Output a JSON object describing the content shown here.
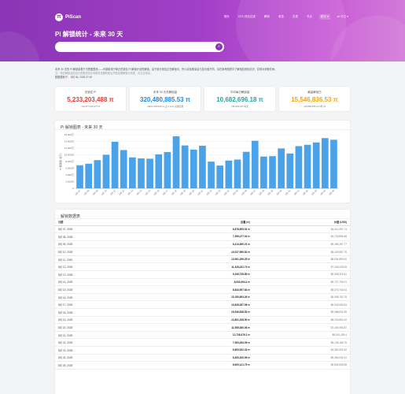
{
  "nav": {
    "logo_mark": "π",
    "logo_text": "PiScan",
    "links": [
      "首页",
      "CEX 钱包过滤",
      "解析",
      "收录",
      "交易",
      "节点"
    ],
    "dropdown": "统计 ▾",
    "language": "zh 中文 ▾"
  },
  "page": {
    "title": "Pi 解锁统计 - 未来 30 天",
    "search_placeholder": "",
    "search_icon": "⌕"
  },
  "intro": {
    "line1": "未来 30 天的 Pi 解锁量基于可视图表统——可能取用于邮迁的钱包 Pi 解锁计划的解锁。由于部分钱包正在解锁中，所以实际数量会与显示值不同，请在参考图表中了解相应钱包情况，并核对到账时间。",
    "line2": "注：钱包解锁会因合约变更或在区块链浏览器转账后不断变更解锁计划表，请注意核实。",
    "line3": "数据更新于：  8月 06, 2025 07:00"
  },
  "stats": [
    {
      "label": "总锁定 Pi",
      "value": "5,233,203,488 π",
      "sub": "≈$1,977,615,377.8",
      "color": "#e53935"
    },
    {
      "label": "未来 30 天总解锁量",
      "value": "320,480,885.53 π",
      "sub": "≈$201,039,504.11  占 6.12% 总锁定量",
      "color": "#1e88e5"
    },
    {
      "label": "平均每日解锁量",
      "value": "10,682,696.18 π",
      "sub": "≈$6,863,187 每天",
      "color": "#26a69a"
    },
    {
      "label": "最高解锁日",
      "value": "15,546,836.53 π",
      "sub": "≈$9,858,655.21  8月 16",
      "color": "#ffa000"
    }
  ],
  "chart_card": {
    "title": "Pi 解锁图表 - 未来 30 天"
  },
  "chart_data": {
    "type": "bar",
    "title": "",
    "xlabel": "",
    "ylabel": "Pi 解锁量 (百万)",
    "ylim": [
      0,
      16000000
    ],
    "yticks": [
      0,
      2000000,
      4000000,
      6000000,
      8000000,
      10000000,
      12000000,
      14000000,
      16000000
    ],
    "ytick_labels": [
      "0",
      "2,000万",
      "4,000万",
      "6,000万",
      "8,000万",
      "10,000万",
      "12,000万",
      "14,000万",
      "16,000万"
    ],
    "grid": true,
    "color": "#4aa3e8",
    "categories": [
      "8月 07",
      "8月 08",
      "8月 09",
      "8月 10",
      "8月 11",
      "8月 12",
      "8月 13",
      "8月 14",
      "8月 15",
      "8月 16",
      "8月 17",
      "8月 18",
      "8月 19",
      "8月 20",
      "8月 21",
      "8月 22",
      "8月 23",
      "8月 24",
      "8月 25",
      "8月 26",
      "8月 27",
      "8月 28",
      "8月 29",
      "8月 30",
      "8月 31",
      "9月 01",
      "9月 02",
      "9月 03",
      "9月 04",
      "9月 05"
    ],
    "values": [
      6878505,
      7359477,
      8414360,
      10027950,
      13901299,
      11425431,
      9245735,
      8932994,
      8843957,
      10150893,
      10828267,
      15546836,
      12801208,
      11555360,
      12728476,
      7963454,
      6800522,
      8300200,
      8600121,
      10900000,
      14200000,
      9500000,
      9600000,
      11900000,
      10400000,
      12600000,
      13000000,
      13700000,
      15000000,
      14500000
    ]
  },
  "table": {
    "title": "解锁数据表",
    "headers": {
      "date": "日期",
      "amount": "总量 (π)",
      "value": "价值 (USD)"
    },
    "rows": [
      {
        "date": "8月 07, 2025",
        "amount": "6,878,505.51 π",
        "value": "$4,410,497.74"
      },
      {
        "date": "8月 08, 2025",
        "amount": "7,359,477.04 π",
        "value": "$4,718,896.68"
      },
      {
        "date": "8月 09, 2025",
        "amount": "8,414,360.21 π",
        "value": "$5,395,287.77"
      },
      {
        "date": "8月 10, 2025",
        "amount": "10,027,950.52 π",
        "value": "$6,429,857.76"
      },
      {
        "date": "8月 11, 2025",
        "amount": "13,901,299.25 π",
        "value": "$8,904,899.00"
      },
      {
        "date": "8月 12, 2025",
        "amount": "11,425,431.74 π",
        "value": "$7,326,028.05"
      },
      {
        "date": "8月 13, 2025",
        "amount": "9,245,735.85 π",
        "value": "$5,928,319.41"
      },
      {
        "date": "8月 14, 2025",
        "amount": "8,932,994.4 π",
        "value": "$5,727,796.01"
      },
      {
        "date": "8月 15, 2025",
        "amount": "8,843,957.64 π",
        "value": "$5,670,745.04"
      },
      {
        "date": "8月 16, 2025",
        "amount": "10,150,893.26 π",
        "value": "$6,508,752.76"
      },
      {
        "date": "8月 17, 2025",
        "amount": "10,828,267.06 π",
        "value": "$6,943,084.84"
      },
      {
        "date": "8月 18, 2025",
        "amount": "15,546,836.53 π",
        "value": "$9,968,631.59"
      },
      {
        "date": "8月 19, 2025",
        "amount": "12,801,208.90 π",
        "value": "$8,203,894.42"
      },
      {
        "date": "8月 20, 2025",
        "amount": "11,555,360.06 π",
        "value": "$7,409,394.87"
      },
      {
        "date": "8月 21, 2025",
        "amount": "12,728,476.1 π",
        "value": "$8,161,429.4"
      },
      {
        "date": "8月 22, 2025",
        "amount": "7,963,454.09 π",
        "value": "$5,106,166.76"
      },
      {
        "date": "8月 23, 2025",
        "amount": "6,800,522.33 π",
        "value": "$4,360,494.92"
      },
      {
        "date": "8月 24, 2025",
        "amount": "8,300,200.99 π",
        "value": "$5,366,031.91"
      },
      {
        "date": "8月 25, 2025",
        "amount": "8,600,121.75 π",
        "value": "$5,505,698.98"
      }
    ]
  }
}
